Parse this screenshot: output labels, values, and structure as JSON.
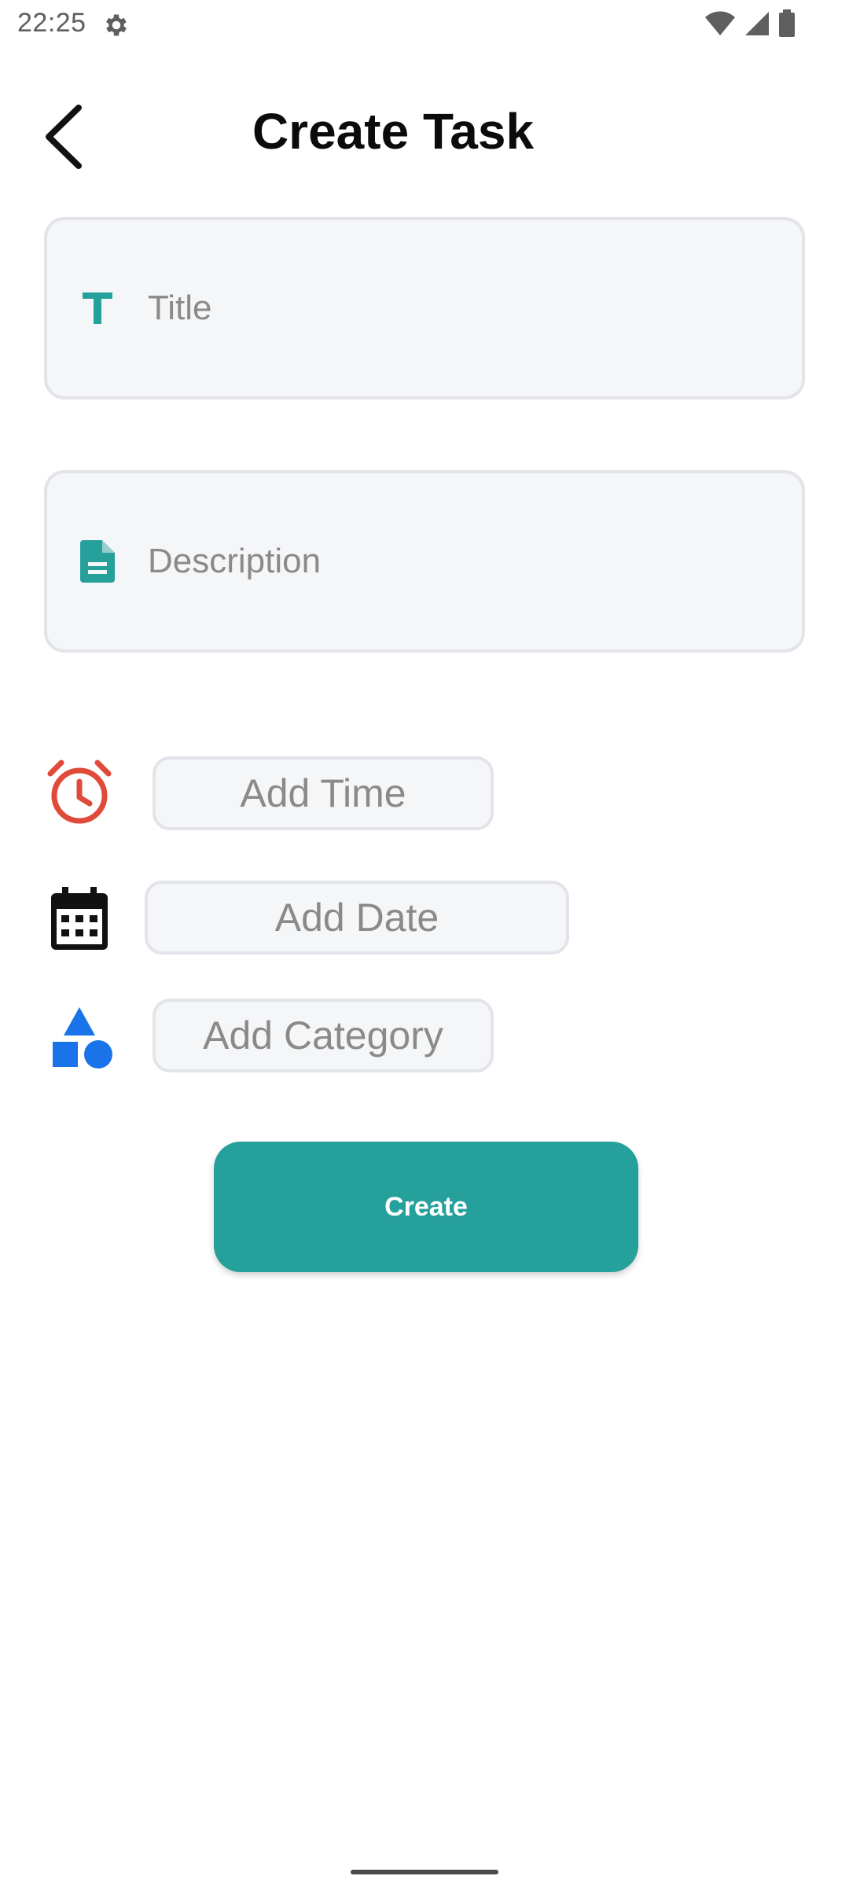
{
  "status_bar": {
    "time": "22:25",
    "icons": [
      "gear-icon",
      "wifi-icon",
      "signal-icon",
      "battery-icon"
    ]
  },
  "header": {
    "title": "Create Task",
    "back_icon": "chevron-left-icon"
  },
  "form": {
    "title_field": {
      "placeholder": "Title",
      "value": "",
      "icon": "text-t-icon",
      "icon_color": "#25a09b"
    },
    "description_field": {
      "placeholder": "Description",
      "value": "",
      "icon": "document-icon",
      "icon_color": "#25a09b"
    },
    "time": {
      "label": "Add Time",
      "icon": "alarm-clock-icon",
      "icon_color": "#e04a3b"
    },
    "date": {
      "label": "Add Date",
      "icon": "calendar-icon",
      "icon_color": "#111111"
    },
    "category": {
      "label": "Add Category",
      "icon": "shapes-icon",
      "icon_color": "#1a73e8"
    },
    "submit_label": "Create"
  },
  "colors": {
    "accent": "#25a09b",
    "field_bg": "#f5f6f8",
    "field_border": "#e2e4ea",
    "placeholder": "#8a8a8a"
  }
}
